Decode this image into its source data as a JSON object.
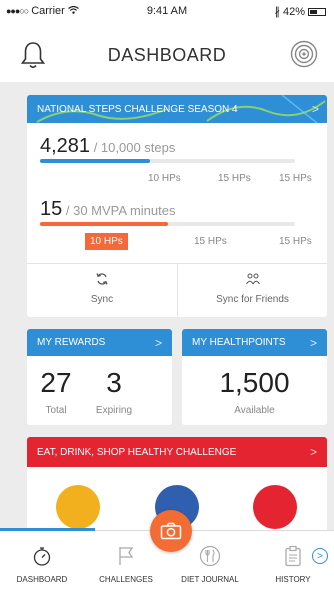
{
  "status_bar": {
    "carrier": "Carrier",
    "time": "9:41 AM",
    "battery": "42%"
  },
  "header": {
    "title": "DASHBOARD",
    "left_icon": "bell-icon",
    "right_icon": "beacon-icon"
  },
  "steps_challenge": {
    "banner": "NATIONAL STEPS CHALLENGE SEASON 4",
    "steps_value": "4,281",
    "steps_goal": "/ 10,000 steps",
    "steps_progress": 0.43,
    "steps_milestones": [
      "10 HPs",
      "15 HPs",
      "15 HPs"
    ],
    "mvpa_value": "15",
    "mvpa_goal": "/ 30 MVPA minutes",
    "mvpa_progress": 0.5,
    "mvpa_milestones": [
      "10 HPs",
      "15 HPs",
      "15 HPs"
    ],
    "sync_label": "Sync",
    "sync_friends_label": "Sync for Friends"
  },
  "rewards": {
    "banner": "MY REWARDS",
    "total_value": "27",
    "total_label": "Total",
    "expiring_value": "3",
    "expiring_label": "Expiring"
  },
  "healthpoints": {
    "banner": "MY HEALTHPOINTS",
    "value": "1,500",
    "label": "Available"
  },
  "eat_challenge": {
    "banner": "EAT, DRINK, SHOP HEALTHY CHALLENGE",
    "category_colors": [
      "#f2b01e",
      "#2f5fae",
      "#e52431"
    ]
  },
  "tabs": [
    {
      "label": "DASHBOARD",
      "icon": "stopwatch-icon"
    },
    {
      "label": "CHALLENGES",
      "icon": "flag-icon"
    },
    {
      "label": "DIET JOURNAL",
      "icon": "utensils-icon"
    },
    {
      "label": "HISTORY",
      "icon": "clipboard-icon"
    }
  ],
  "colors": {
    "accent_blue": "#2f8fd6",
    "accent_orange": "#f3693a",
    "accent_red": "#e52431"
  }
}
